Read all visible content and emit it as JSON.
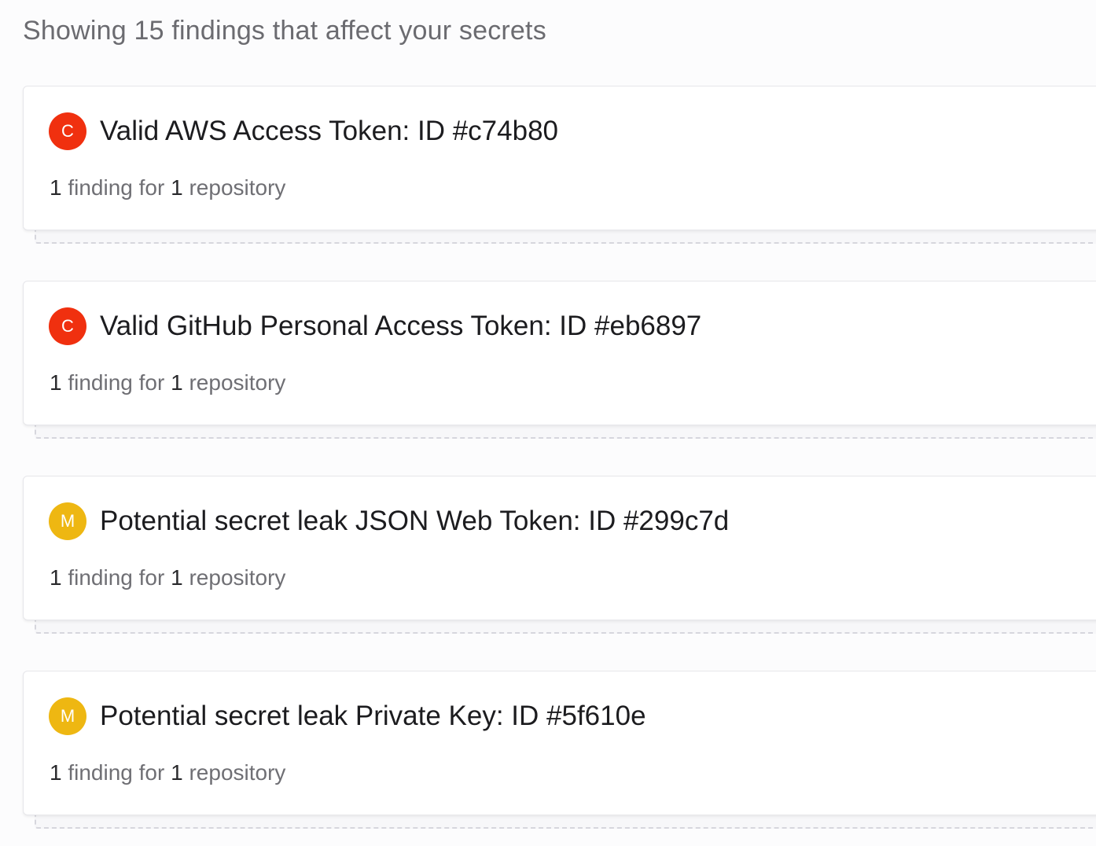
{
  "summary": "Showing 15 findings that affect your secrets",
  "colors": {
    "critical": "#f0300f",
    "medium": "#eeb712"
  },
  "findings": [
    {
      "severity_letter": "C",
      "severity": "critical",
      "title": "Valid AWS Access Token: ID #c74b80",
      "finding_count": "1",
      "finding_text": "finding for",
      "repo_count": "1",
      "repo_text": "repository"
    },
    {
      "severity_letter": "C",
      "severity": "critical",
      "title": "Valid GitHub Personal Access Token: ID #eb6897",
      "finding_count": "1",
      "finding_text": "finding for",
      "repo_count": "1",
      "repo_text": "repository"
    },
    {
      "severity_letter": "M",
      "severity": "medium",
      "title": "Potential secret leak JSON Web Token: ID #299c7d",
      "finding_count": "1",
      "finding_text": "finding for",
      "repo_count": "1",
      "repo_text": "repository"
    },
    {
      "severity_letter": "M",
      "severity": "medium",
      "title": "Potential secret leak Private Key: ID #5f610e",
      "finding_count": "1",
      "finding_text": "finding for",
      "repo_count": "1",
      "repo_text": "repository"
    }
  ]
}
